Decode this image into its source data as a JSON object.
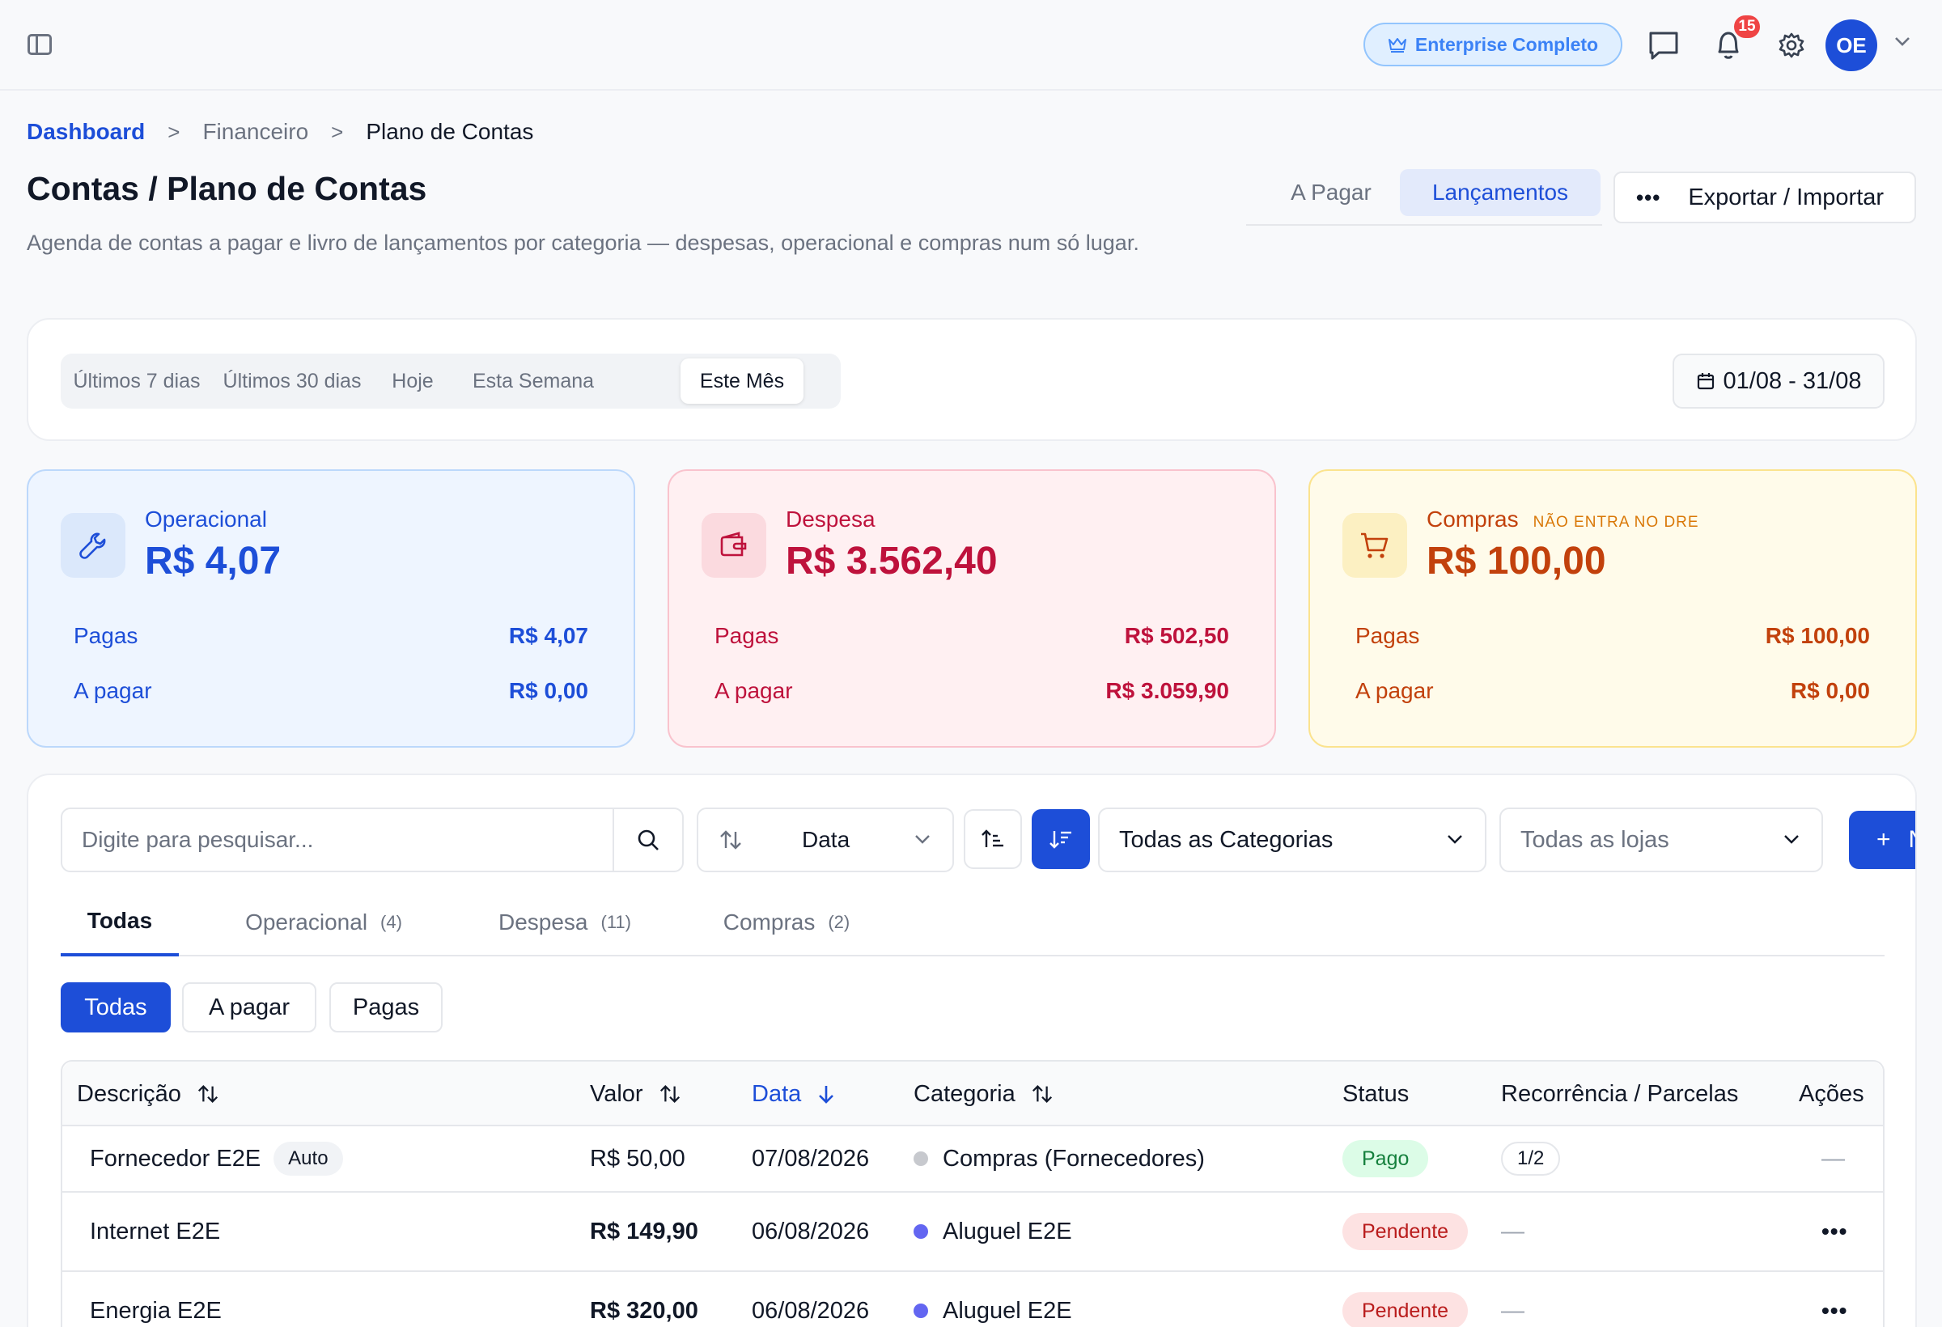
{
  "topbar": {
    "plan_label": "Enterprise Completo",
    "notification_count": "15",
    "avatar_initials": "OE"
  },
  "breadcrumb": {
    "home": "Dashboard",
    "section": "Financeiro",
    "current": "Plano de Contas",
    "separator": ">"
  },
  "header": {
    "title": "Contas / Plano de Contas",
    "description": "Agenda de contas a pagar e livro de lançamentos por categoria — despesas, operacional e compras num só lugar.",
    "tabs": [
      "A Pagar",
      "Lançamentos"
    ],
    "active_tab": "Lançamentos",
    "export_label": "Exportar / Importar",
    "more_glyph": "•••"
  },
  "period": {
    "options": [
      "Últimos 7 dias",
      "Últimos 30 dias",
      "Hoje",
      "Esta Semana",
      "Este Mês"
    ],
    "active": "Este Mês",
    "date_range": "01/08 - 31/08"
  },
  "summary": {
    "operacional": {
      "label": "Operacional",
      "total": "R$ 4,07",
      "paid_label": "Pagas",
      "paid": "R$ 4,07",
      "due_label": "A pagar",
      "due": "R$ 0,00"
    },
    "despesa": {
      "label": "Despesa",
      "total": "R$ 3.562,40",
      "paid_label": "Pagas",
      "paid": "R$ 502,50",
      "due_label": "A pagar",
      "due": "R$ 3.059,90"
    },
    "compras": {
      "label": "Compras",
      "note": "NÃO ENTRA NO DRE",
      "total": "R$ 100,00",
      "paid_label": "Pagas",
      "paid": "R$ 100,00",
      "due_label": "A pagar",
      "due": "R$ 0,00"
    }
  },
  "filters": {
    "search_placeholder": "Digite para pesquisar...",
    "sort_field": "Data",
    "category_select": "Todas as Categorias",
    "store_select": "Todas as lojas",
    "new_label": "N",
    "plus_glyph": "+"
  },
  "type_tabs": [
    {
      "label": "Todas",
      "count": ""
    },
    {
      "label": "Operacional",
      "count": "(4)"
    },
    {
      "label": "Despesa",
      "count": "(11)"
    },
    {
      "label": "Compras",
      "count": "(2)"
    }
  ],
  "status_chips": [
    "Todas",
    "A pagar",
    "Pagas"
  ],
  "table": {
    "columns": [
      "Descrição",
      "Valor",
      "Data",
      "Categoria",
      "Status",
      "Recorrência / Parcelas",
      "Ações"
    ],
    "rows": [
      {
        "description": "Fornecedor E2E",
        "tag": "Auto",
        "value": "R$ 50,00",
        "date": "07/08/2026",
        "category": "Compras (Fornecedores)",
        "category_color": "#c7c9ce",
        "status": "Pago",
        "recurrence": "1/2",
        "actions": "—"
      },
      {
        "description": "Internet E2E",
        "tag": "",
        "value": "R$ 149,90",
        "date": "06/08/2026",
        "category": "Aluguel E2E",
        "category_color": "#6366f1",
        "status": "Pendente",
        "recurrence": "—",
        "actions": "•••"
      },
      {
        "description": "Energia E2E",
        "tag": "",
        "value": "R$ 320,00",
        "date": "06/08/2026",
        "category": "Aluguel E2E",
        "category_color": "#6366f1",
        "status": "Pendente",
        "recurrence": "—",
        "actions": "•••"
      }
    ]
  }
}
